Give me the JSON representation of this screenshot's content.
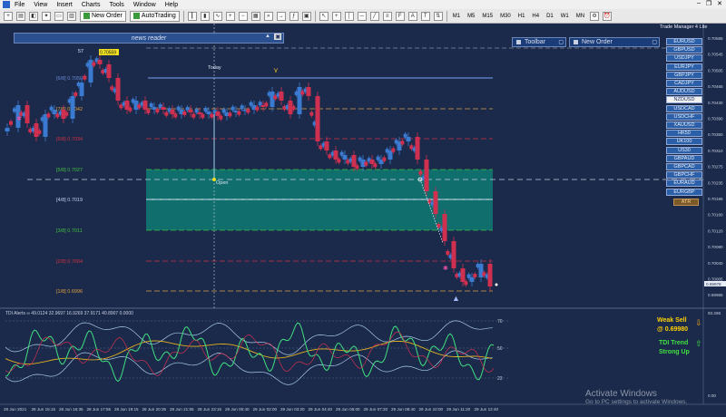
{
  "menu": {
    "items": [
      "File",
      "View",
      "Insert",
      "Charts",
      "Tools",
      "Window",
      "Help"
    ]
  },
  "toolbar": {
    "new_order": "New Order",
    "auto_trading": "AutoTrading",
    "timeframes": [
      "M1",
      "M5",
      "M15",
      "M30",
      "H1",
      "H4",
      "D1",
      "W1",
      "MN"
    ]
  },
  "panels": {
    "news_reader": "news reader",
    "toolbar_title": "Toolbar",
    "new_order_title": "New Order",
    "trade_manager": "Trade Manager 4 Lite"
  },
  "symbols": [
    "EURUSD",
    "GBPUSD",
    "USDJPY",
    "EURJPY",
    "GBPJPY",
    "CADJPY",
    "AUDUSD",
    "NZDUSD",
    "USDCAD",
    "USDCHF",
    "XAUUSD",
    "HK50",
    "UK100",
    "US30",
    "GBPAUD",
    "GBPCAD",
    "GBPCHF",
    "EURAUD",
    "EURGBP"
  ],
  "selected_symbol": "NZDUSD",
  "atr_label": "ATR",
  "chart_labels": {
    "today": "Today",
    "open": "Open",
    "candle_counter": "57",
    "price_tag": "0.70559"
  },
  "levels": [
    {
      "label": "[6/8]",
      "value": "0.7050",
      "color": "#6a8ad8"
    },
    {
      "label": "[7/8]",
      "value": "0.7042",
      "color": "#e0a040"
    },
    {
      "label": "[6/8]",
      "value": "0.7034",
      "color": "#d03040"
    },
    {
      "label": "[5/8]",
      "value": "0.7027",
      "color": "#40c040"
    },
    {
      "label": "[4/8]",
      "value": "0.7019",
      "color": "#c0d0f0"
    },
    {
      "label": "[3/8]",
      "value": "0.7011",
      "color": "#40c040"
    },
    {
      "label": "[2/8]",
      "value": "0.7004",
      "color": "#d03040"
    },
    {
      "label": "[1/8]",
      "value": "0.6996",
      "color": "#e0a040"
    }
  ],
  "price_axis": [
    "0.70585",
    "0.70545",
    "0.70505",
    "0.70465",
    "0.70430",
    "0.70390",
    "0.70350",
    "0.70310",
    "0.70275",
    "0.70235",
    "0.70195",
    "0.70160",
    "0.70120",
    "0.70080",
    "0.70040",
    "0.70005",
    "0.69965"
  ],
  "current_price": "0.69978",
  "indicator": {
    "header": "TDI Alerts ∞ 49.0124 32.9697 16.9269 37.9171 40.8907 0.0000",
    "levels": [
      "70",
      "50",
      "23"
    ],
    "axis": [
      "93.286",
      "0.00"
    ],
    "signal_text": "Weak Sell",
    "signal_price": "@ 0.69980",
    "trend_text": "TDI Trend",
    "trend_strength": "Strong Up"
  },
  "time_axis": [
    "28 Jun 2021",
    "28 Jun 15:15",
    "28 Jun 16:35",
    "28 Jun 17:55",
    "28 Jun 19:15",
    "28 Jun 20:35",
    "28 Jun 21:55",
    "28 Jun 23:15",
    "29 Jun 00:40",
    "29 Jun 02:00",
    "29 Jun 03:20",
    "29 Jun 04:40",
    "29 Jun 06:00",
    "29 Jun 07:20",
    "29 Jun 08:40",
    "29 Jun 10:00",
    "29 Jun 11:20",
    "29 Jun 12:40"
  ],
  "watermark": {
    "title": "Activate Windows",
    "subtitle": "Go to PC settings to activate Windows."
  },
  "colors": {
    "background": "#1b2a4a",
    "zone": "#0e7a72",
    "bull": "#3a7ad0",
    "bear": "#d03050"
  }
}
